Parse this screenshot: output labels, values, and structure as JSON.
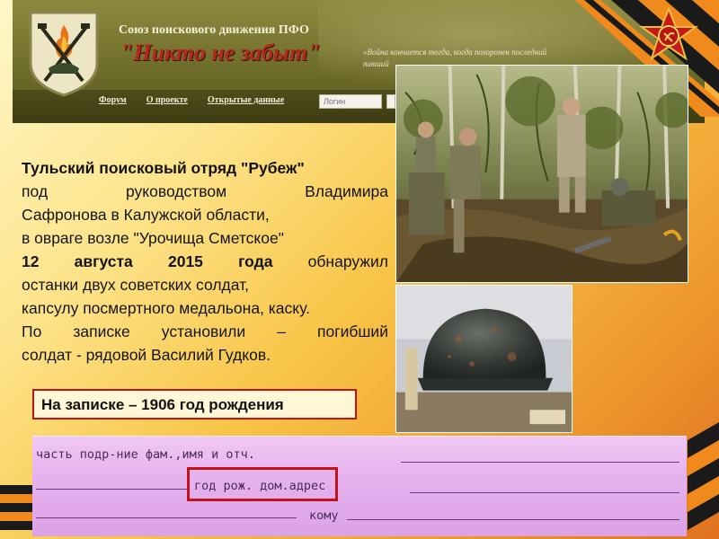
{
  "header": {
    "org_name": "Союз поискового движения ПФО",
    "site_name": "\"Никто не забыт\"",
    "quote_line1": "«Война кончается тогда, когда похоронен последний",
    "quote_line2": "павший"
  },
  "nav": {
    "items": [
      {
        "label": "Форум"
      },
      {
        "label": "О проекте"
      },
      {
        "label": "Открытые данные"
      }
    ],
    "login_placeholder": "Логин"
  },
  "main": {
    "lines": [
      {
        "text": "Тульский поисковый отряд \"Рубеж\"",
        "bold": true
      },
      {
        "text": "под руководством Владимира",
        "bold": false
      },
      {
        "text": "Сафронова в Калужской области,",
        "bold": false
      },
      {
        "text": "в овраге возле \"Урочища Сметское\"",
        "bold": false
      },
      {
        "bold_prefix": "12 августа 2015 года",
        "rest": " обнаружил"
      },
      {
        "text": "останки двух советских солдат,",
        "bold": false
      },
      {
        "text": "капсулу посмертного медальона, каску.",
        "bold": false
      },
      {
        "text": "По записке установили – погибший",
        "bold": false
      },
      {
        "text": "солдат - рядовой Василий Гудков.",
        "bold": false
      }
    ],
    "callout": "На записке – 1906 год рождения"
  },
  "document": {
    "row1": "часть     подр-ние         фам.,имя и отч.",
    "row2": "год рож.          дом.адрес",
    "row3": "кому"
  },
  "colors": {
    "accent_red": "#c0141a",
    "header_olive": "#6f6d2b",
    "doc_pink": "#e6b2ee"
  }
}
